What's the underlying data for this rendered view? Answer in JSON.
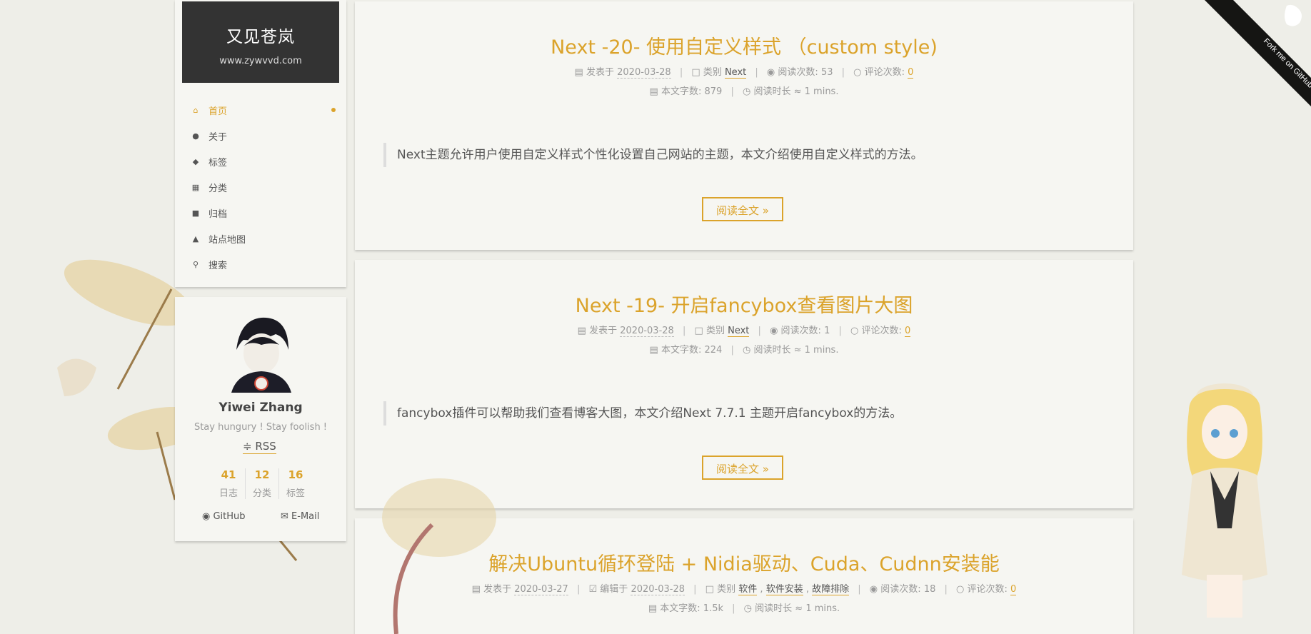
{
  "site": {
    "title": "又见苍岚",
    "subtitle": "www.zywvvd.com"
  },
  "menu": [
    {
      "label": "首页",
      "icon": "home-icon",
      "active": true
    },
    {
      "label": "关于",
      "icon": "user-icon"
    },
    {
      "label": "标签",
      "icon": "tags-icon"
    },
    {
      "label": "分类",
      "icon": "th-icon"
    },
    {
      "label": "归档",
      "icon": "archive-icon"
    },
    {
      "label": "站点地图",
      "icon": "sitemap-icon"
    },
    {
      "label": "搜索",
      "icon": "search-icon"
    }
  ],
  "profile": {
    "name": "Yiwei Zhang",
    "motto": "Stay hungury ! Stay foolish !",
    "rss": "RSS",
    "stats": [
      {
        "num": "41",
        "label": "日志"
      },
      {
        "num": "12",
        "label": "分类"
      },
      {
        "num": "16",
        "label": "标签"
      }
    ],
    "github": "GitHub",
    "email": "E-Mail"
  },
  "meta_labels": {
    "posted": "发表于",
    "edited": "编辑于",
    "category": "类别",
    "views": "阅读次数:",
    "comments": "评论次数:",
    "words": "本文字数:",
    "read_time": "阅读时长 ≈"
  },
  "posts": [
    {
      "title": "Next -20- 使用自定义样式 （custom style)",
      "date": "2020-03-28",
      "category": "Next",
      "views": "53",
      "comments": "0",
      "words": "879",
      "read_time": "1 mins.",
      "excerpt": "Next主题允许用户使用自定义样式个性化设置自己网站的主题，本文介绍使用自定义样式的方法。",
      "read_more": "阅读全文 »"
    },
    {
      "title": "Next -19- 开启fancybox查看图片大图",
      "date": "2020-03-28",
      "category": "Next",
      "views": "1",
      "comments": "0",
      "words": "224",
      "read_time": "1 mins.",
      "excerpt": "fancybox插件可以帮助我们查看博客大图，本文介绍Next 7.7.1 主题开启fancybox的方法。",
      "read_more": "阅读全文 »"
    },
    {
      "title": "解决Ubuntu循环登陆 + Nidia驱动、Cuda、Cudnn安装能",
      "date": "2020-03-27",
      "edited": "2020-03-28",
      "categories": [
        "软件",
        "软件安装",
        "故障排除"
      ],
      "views": "18",
      "comments": "0",
      "words": "1.5k",
      "read_time": "1 mins."
    }
  ],
  "ribbon": {
    "text": "Fork me on GitHub"
  },
  "colors": {
    "accent": "#dba32b",
    "brand_bg": "#333333",
    "page_bg": "#eeeee8"
  }
}
